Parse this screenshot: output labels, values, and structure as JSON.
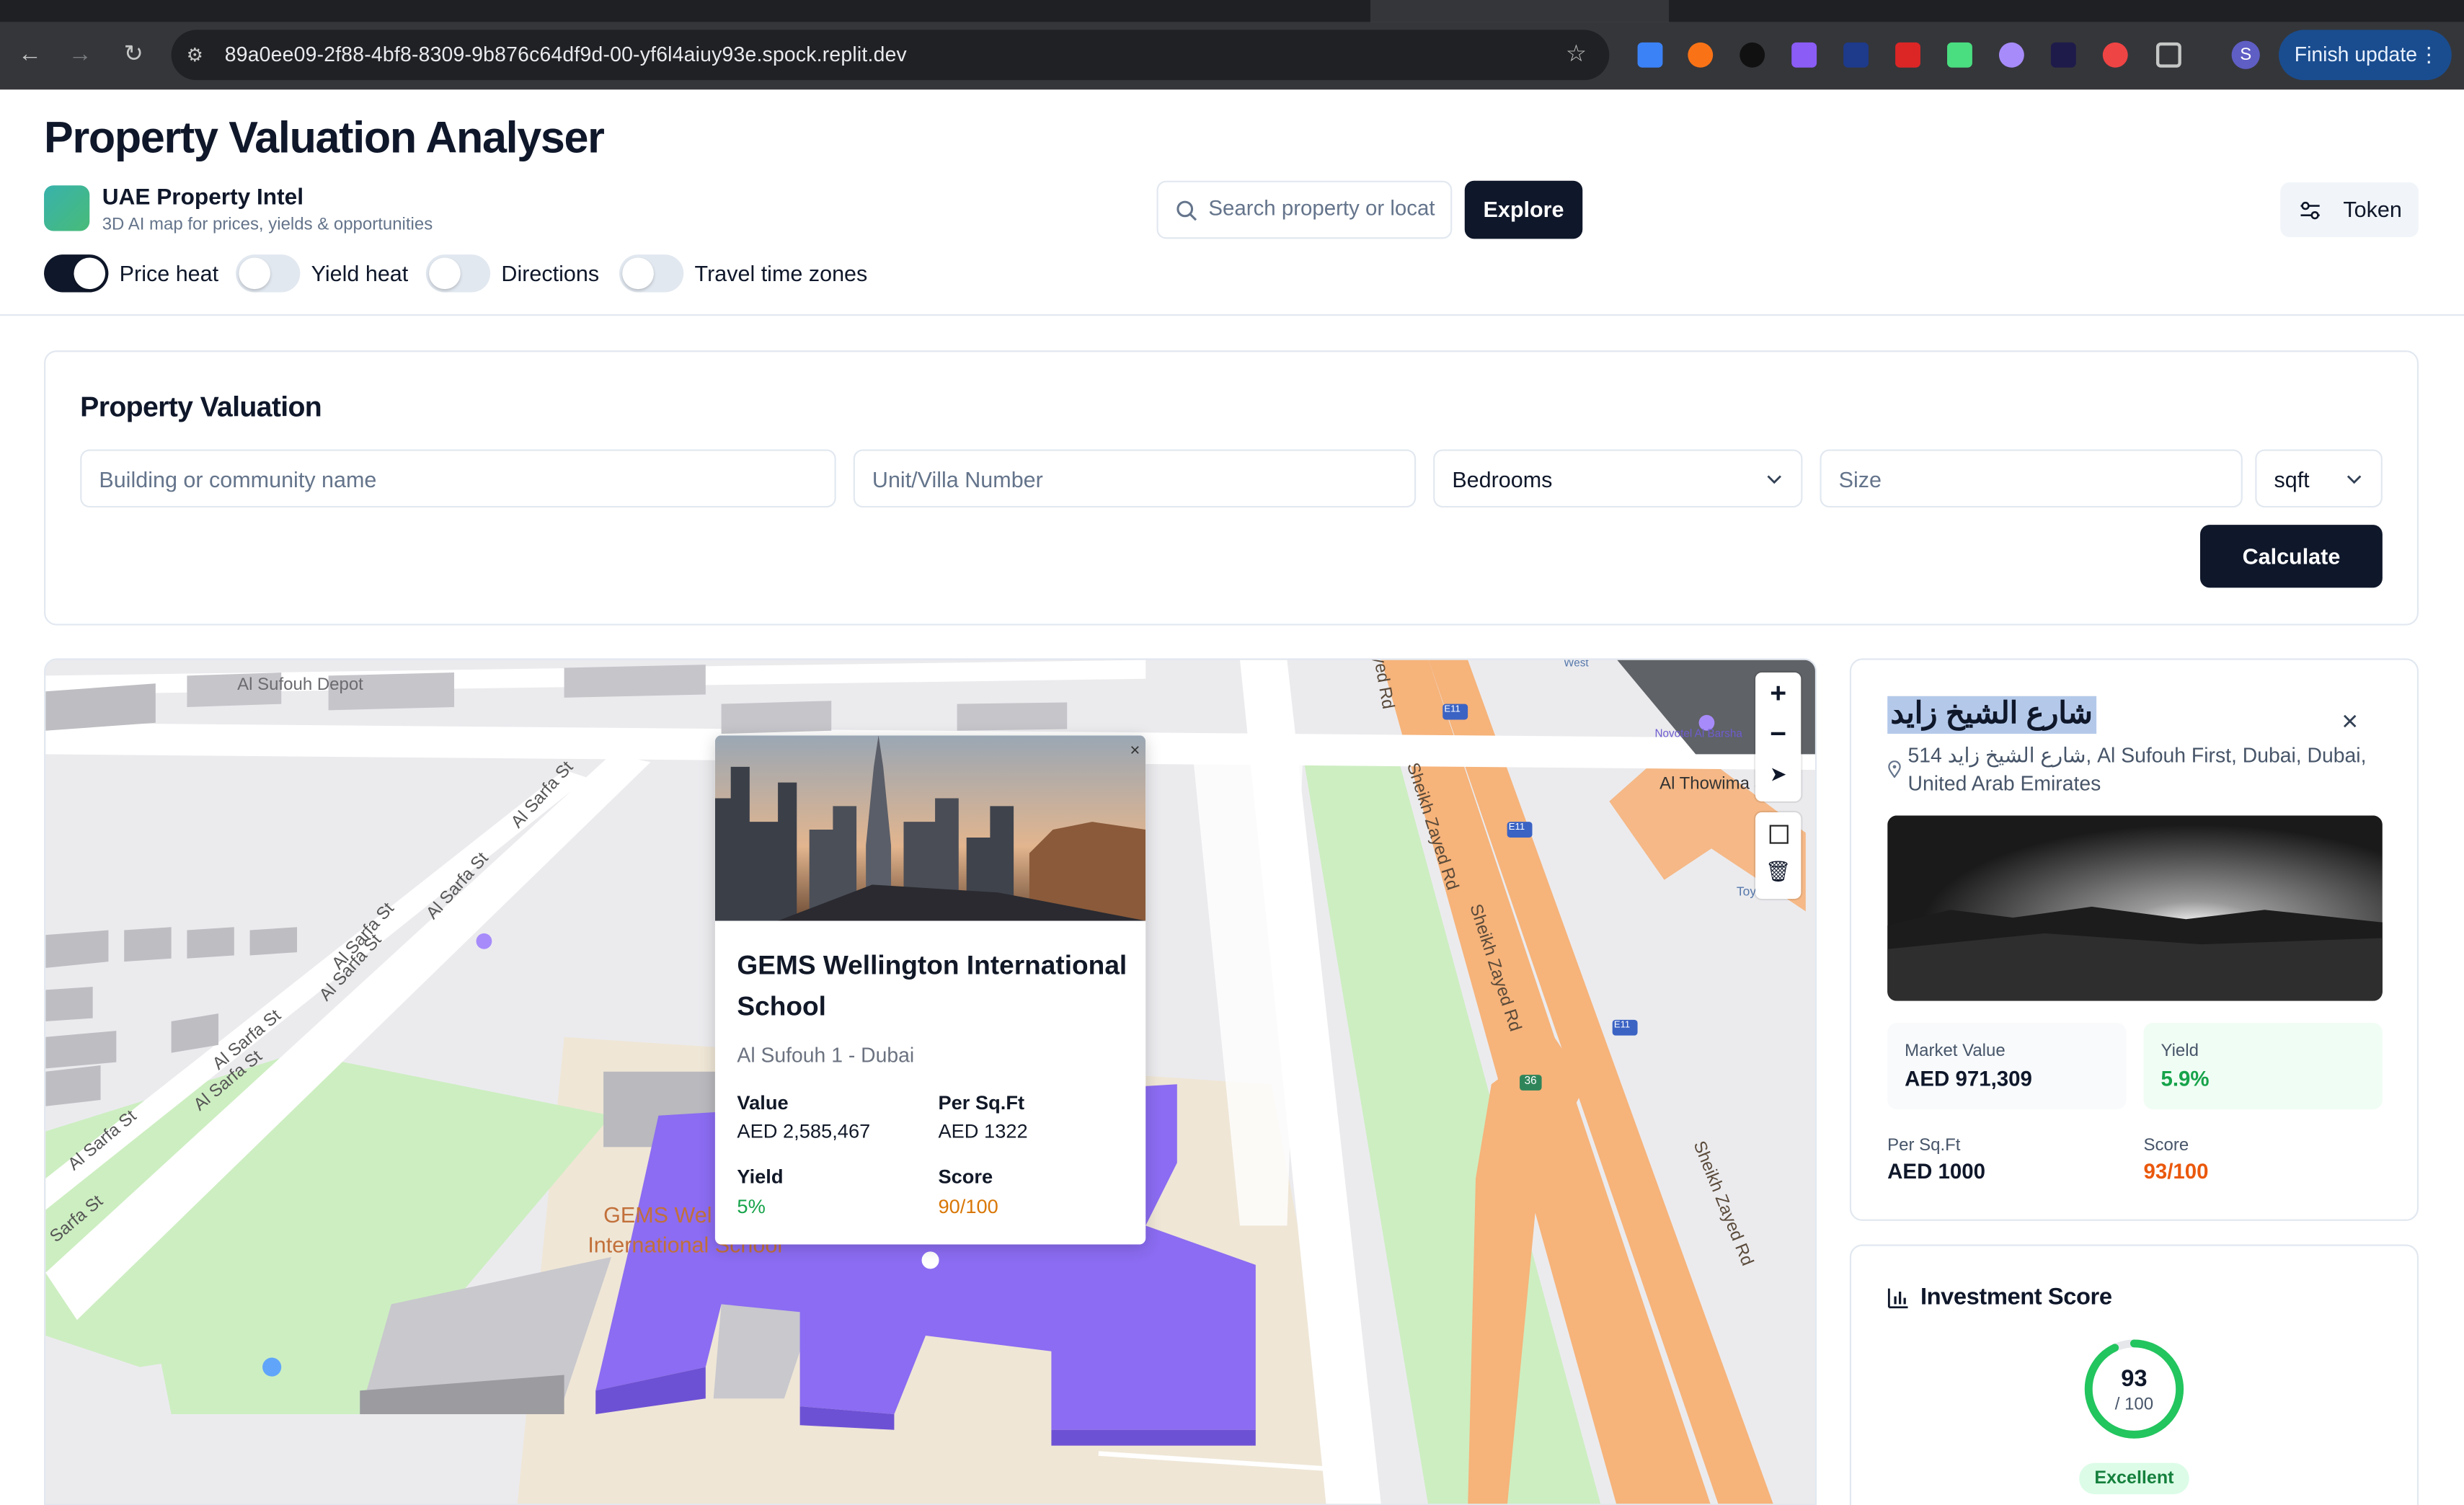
{
  "browser": {
    "url": "89a0ee09-2f88-4bf8-8309-9b876c64df9d-00-yf6l4aiuy93e.spock.replit.dev",
    "finish_update": "Finish update",
    "profile_initial": "S"
  },
  "header": {
    "title": "Property Valuation Analyser",
    "brand_name": "UAE Property Intel",
    "brand_sub": "3D AI map for prices, yields & opportunities",
    "search_placeholder": "Search property or locat",
    "explore_label": "Explore",
    "token_label": "Token"
  },
  "toggles": [
    {
      "label": "Price heat",
      "on": true
    },
    {
      "label": "Yield heat",
      "on": false
    },
    {
      "label": "Directions",
      "on": false
    },
    {
      "label": "Travel time zones",
      "on": false
    }
  ],
  "valuation": {
    "heading": "Property Valuation",
    "building_placeholder": "Building or community name",
    "unit_placeholder": "Unit/Villa Number",
    "bedrooms_value": "Bedrooms",
    "size_placeholder": "Size",
    "unit_select": "sqft",
    "calculate_label": "Calculate"
  },
  "map": {
    "labels": {
      "depot": "Al Sufouh Depot",
      "sarfa": "Al Sarfa St",
      "sarfa_cut": "Sarfa St",
      "szr": "Sheikh Zayed Rd",
      "zayed_cut": "ayed Rd",
      "thowima": "Al Thowima S",
      "school_l1": "GEMS Wel",
      "school_l2": "International School",
      "e11": "E11",
      "r36": "36",
      "west": "West",
      "toy": "Toy",
      "novotel": "Novotel Al Barsha"
    },
    "popup": {
      "title": "GEMS Wellington International School",
      "location": "Al Sufouh 1 - Dubai",
      "value_label": "Value",
      "value": "AED 2,585,467",
      "persqft_label": "Per Sq.Ft",
      "persqft": "AED 1322",
      "yield_label": "Yield",
      "yield": "5%",
      "score_label": "Score",
      "score": "90/100",
      "close": "×"
    }
  },
  "details": {
    "name": "شارع الشيخ زايد",
    "address": "514 شارع الشيخ زايد, Al Sufouh First, Dubai, Dubai, United Arab Emirates",
    "market_value_label": "Market Value",
    "market_value": "AED 971,309",
    "yield_label": "Yield",
    "yield": "5.9%",
    "persqft_label": "Per Sq.Ft",
    "persqft": "AED 1000",
    "score_label": "Score",
    "score": "93/100"
  },
  "investment": {
    "heading": "Investment Score",
    "score": "93",
    "out_of": "/ 100",
    "score_fraction": 0.93,
    "rating": "Excellent"
  },
  "colors": {
    "primary": "#0f172a",
    "accent_green": "#16a34a",
    "accent_orange": "#ea580c",
    "building_purple": "#8b6cf2",
    "road_orange": "#f6b37a"
  }
}
